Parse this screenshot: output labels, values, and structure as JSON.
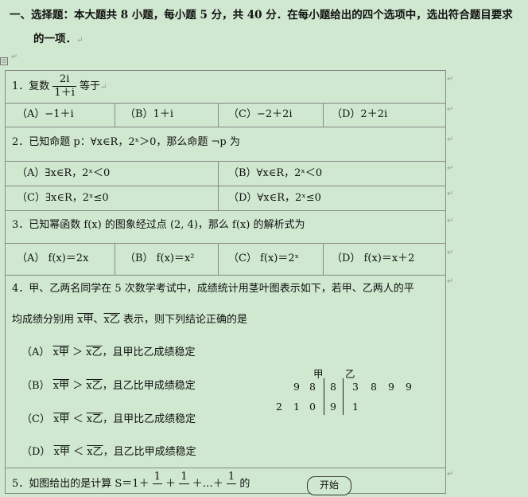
{
  "heading": {
    "line1": "一、选择题：本大题共 8 小题，每小题 5 分，共 40 分．在每小题给出的四个选项中，选出符合题目要求",
    "line2": "的一项．"
  },
  "q1": {
    "prefix": "1．复数",
    "frac_num": "2i",
    "frac_den": "1＋i",
    "suffix": "等于",
    "options": [
      "（A）−1＋i",
      "（B）1＋i",
      "（C）−2＋2i",
      "（D）2＋2i"
    ]
  },
  "q2": {
    "text": "2．已知命题 p：∀x∈R，2ˣ＞0，那么命题 ¬p 为",
    "options": [
      "（A）∃x∈R，2ˣ＜0",
      "（B）∀x∈R，2ˣ＜0",
      "（C）∃x∈R，2ˣ≤0",
      "（D）∀x∈R，2ˣ≤0"
    ]
  },
  "q3": {
    "text": "3．已知幂函数 f(x) 的图象经过点 (2, 4)，那么 f(x) 的解析式为",
    "options": [
      "（A） f(x)＝2x",
      "（B） f(x)＝x²",
      "（C） f(x)＝2ˣ",
      "（D） f(x)＝x＋2"
    ]
  },
  "q4": {
    "text1": "4．甲、乙两名同学在 5 次数学考试中，成绩统计用茎叶图表示如下，若甲、乙两人的平",
    "text2_pre": "均成绩分别用",
    "x_jia": "x甲",
    "sep": "、",
    "x_yi": "x乙",
    "text2_post": "表示，则下列结论正确的是",
    "options": [
      {
        "label": "（A）",
        "a": "x甲",
        "op": "＞",
        "b": "x乙",
        "tail": "，且甲比乙成绩稳定"
      },
      {
        "label": "（B）",
        "a": "x甲",
        "op": "＞",
        "b": "x乙",
        "tail": "，且乙比甲成绩稳定"
      },
      {
        "label": "（C）",
        "a": "x甲",
        "op": "＜",
        "b": "x乙",
        "tail": "，且甲比乙成绩稳定"
      },
      {
        "label": "（D）",
        "a": "x甲",
        "op": "＜",
        "b": "x乙",
        "tail": "，且乙比甲成绩稳定"
      }
    ],
    "stemleaf": {
      "head_jia": "甲",
      "head_yi": "乙",
      "row1": {
        "left": [
          "9",
          "8"
        ],
        "stem": "8",
        "right": [
          "3",
          "8",
          "9",
          "9"
        ]
      },
      "row2": {
        "left": [
          "2",
          "1",
          "0"
        ],
        "stem": "9",
        "right": [
          "1"
        ]
      }
    }
  },
  "q5": {
    "prefix": "5．如图给出的是计算 S＝1＋",
    "plus": "＋",
    "tail": "＋…＋",
    "frac_num": "1",
    "suffix": "的",
    "flow_start": "开始"
  },
  "marks": {
    "para": "↵",
    "anchor": "⊞"
  }
}
